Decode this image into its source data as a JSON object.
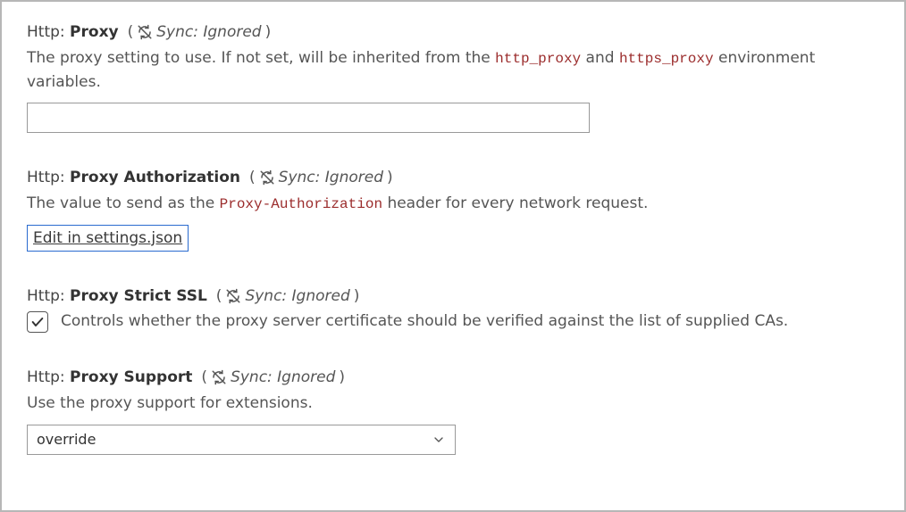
{
  "sync_ignored_label": "Sync: Ignored",
  "settings": {
    "proxy": {
      "category": "Http:",
      "name": "Proxy",
      "desc_pre": "The proxy setting to use. If not set, will be inherited from the ",
      "code1": "http_proxy",
      "desc_mid": " and ",
      "code2": "https_proxy",
      "desc_post": " environment variables.",
      "value": ""
    },
    "proxy_authorization": {
      "category": "Http:",
      "name": "Proxy Authorization",
      "desc_pre": "The value to send as the ",
      "code1": "Proxy-Authorization",
      "desc_post": " header for every network request.",
      "link_label": "Edit in settings.json"
    },
    "proxy_strict_ssl": {
      "category": "Http:",
      "name": "Proxy Strict SSL",
      "desc": "Controls whether the proxy server certificate should be verified against the list of supplied CAs.",
      "checked": true
    },
    "proxy_support": {
      "category": "Http:",
      "name": "Proxy Support",
      "desc": "Use the proxy support for extensions.",
      "value": "override"
    }
  }
}
